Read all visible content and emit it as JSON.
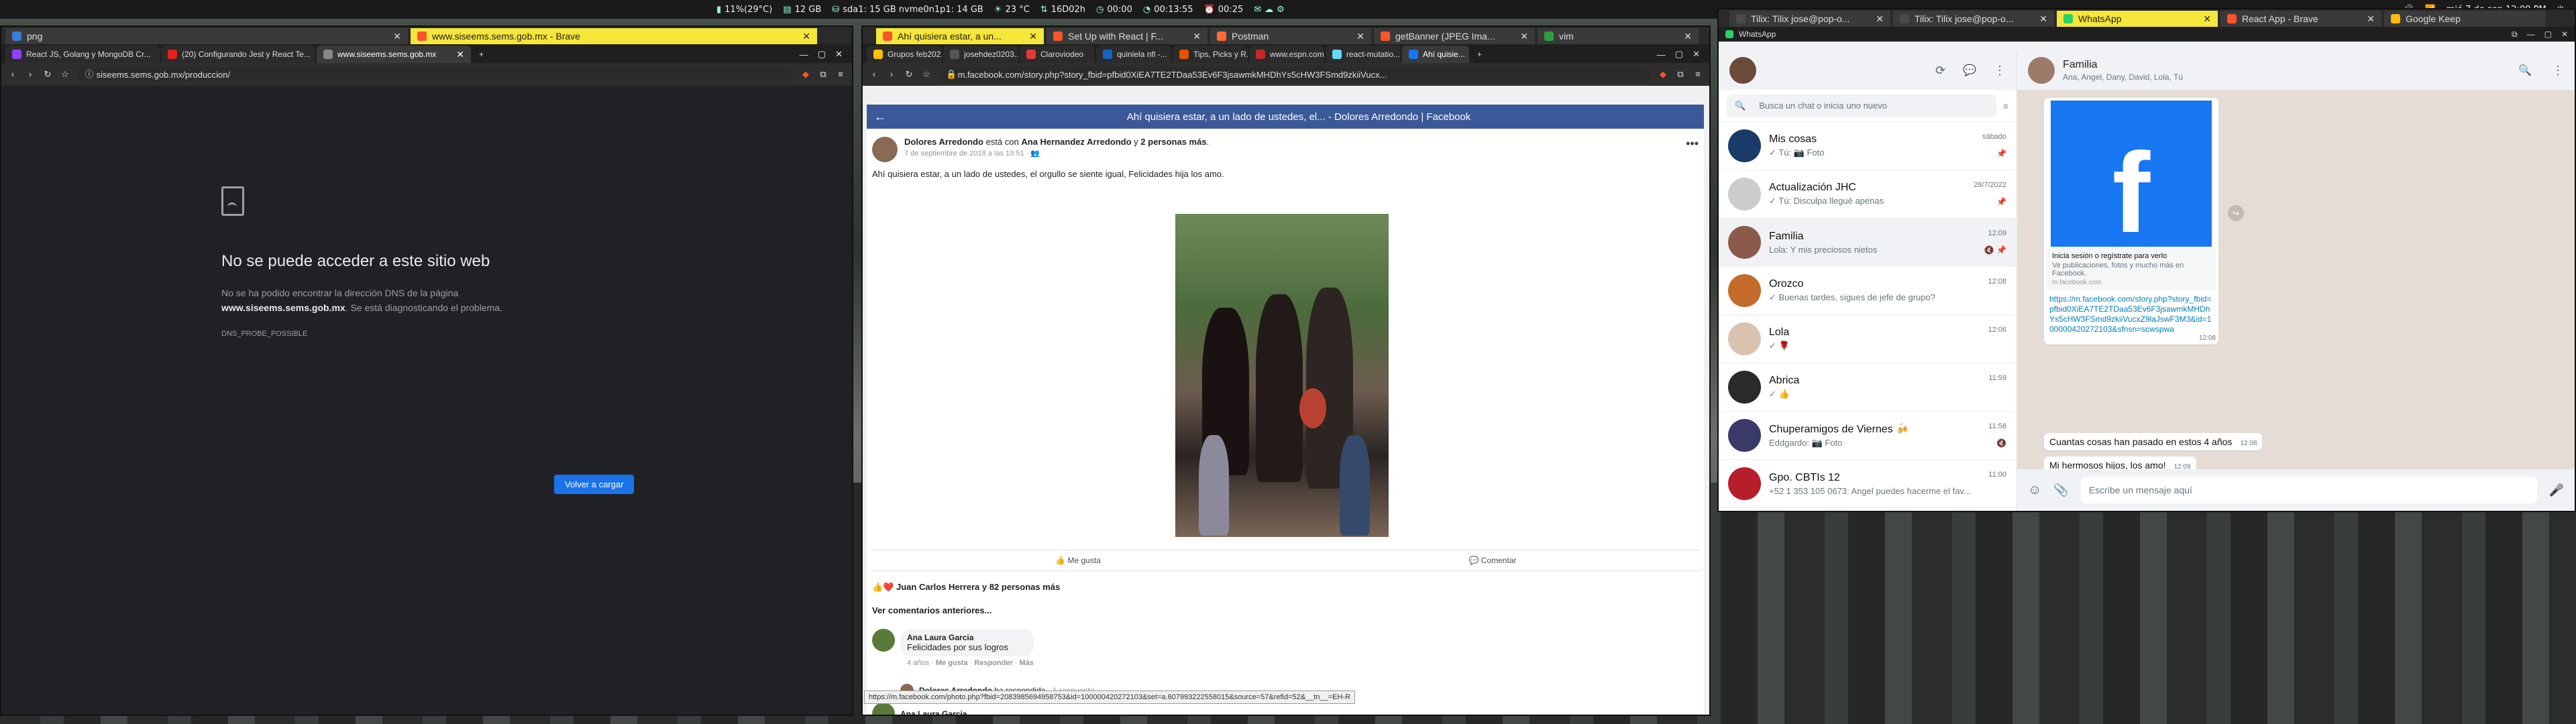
{
  "panel": {
    "weather_temp": "11%(29°C)",
    "memory": "12 GB",
    "disk": "sda1: 15 GB nvme0n1p1: 14 GB",
    "temp2": "23 °C",
    "net": "16D02h",
    "clock1": "00:00",
    "clock2": "00:13:55",
    "clock3": "00:25",
    "date": "mié 7 de sep 12:09 PM"
  },
  "win1": {
    "title_tab1": "png",
    "title_tab2": "www.siseems.sems.gob.mx - Brave",
    "tabs": [
      "React JS, Golang y MongoDB Cr...",
      "(20) Configurando Jest y React Te...",
      "www.siseems.sems.gob.mx"
    ],
    "url": "siseems.sems.gob.mx/produccion/",
    "error": {
      "heading": "No se puede acceder a este sitio web",
      "line1": "No se ha podido encontrar la dirección DNS de la página",
      "domain": "www.siseems.sems.gob.mx",
      "line2": ". Se está diagnosticando el problema.",
      "code": "DNS_PROBE_POSSIBLE",
      "reload": "Volver a cargar"
    }
  },
  "win2": {
    "title_tabs": [
      "Ahí quisiera estar, a un...",
      "Set Up with React | F...",
      "Postman",
      "getBanner (JPEG Ima...",
      "vim"
    ],
    "tabs": [
      "Grupos feb202...",
      "josehdez0203...",
      "Claroviodeo",
      "quiniela nfl -...",
      "Tips, Picks y R...",
      "www.espn.com...",
      "react-mutatio...",
      "Ahí quisie..."
    ],
    "url": "m.facebook.com/story.php?story_fbid=pfbid0XiEA7TE2TDaa53Ev6F3jsawmkMHDhYs5cHW3FSmd9zkiiVucx...",
    "fb_title": "Ahí quisiera estar, a un lado de ustedes, el... - Dolores Arredondo | Facebook",
    "post": {
      "author": "Dolores Arredondo",
      "with_text": " está con ",
      "with1": "Ana Hernandez Arredondo",
      "with_and": " y ",
      "with2": "2 personas más",
      "date": "7 de septiembre de 2018 a las 19:51 · ",
      "text": "Ahí quisiera estar, a un lado de ustedes, el orgullo se siente igual, Felicidades hija los amo.",
      "like": "Me gusta",
      "comment": "Comentar",
      "reactions": "Juan Carlos Herrera y 82 personas más",
      "more_comments": "Ver comentarios anteriores...",
      "c1_author": "Ana Laura Garcia",
      "c1_text": "Felicidades por sus logros",
      "c1_time": "4 años",
      "c1_like": "Me gusta",
      "c1_reply": "Responder",
      "c1_more": "Más",
      "reply_author": "Dolores Arredondo",
      "reply_text": " ha respondido",
      "reply_count": " · 1 respuesta",
      "c2_author": "Ana Laura Garcia"
    },
    "status_url": "https://m.facebook.com/photo.php?fbid=2083985694958753&id=100000420272103&set=a.607993222558015&source=57&refid=52&__tn__=EH-R"
  },
  "win3": {
    "title_tabs": [
      "Tilix: Tilix jose@pop-o...",
      "Tilix: Tilix jose@pop-o...",
      "WhatsApp",
      "React App - Brave",
      "Google Keep"
    ],
    "app_title": "WhatsApp",
    "search_placeholder": "Busca un chat o inicia uno nuevo",
    "chats": [
      {
        "name": "Mis cosas",
        "last": "✓ Tú: 📷 Foto",
        "time": "sábado",
        "pin": "📌"
      },
      {
        "name": "Actualización JHC",
        "last": "✓ Tú: Disculpa llegué apenas",
        "time": "28/7/2022",
        "pin": "📌"
      },
      {
        "name": "Familia",
        "last": "Lola: Y mis preciosos nietos",
        "time": "12:09",
        "pin": "🔇 📌"
      },
      {
        "name": "Orozco",
        "last": "✓ Buenas tardes, sigues de jefe de grupo?",
        "time": "12:08",
        "pin": ""
      },
      {
        "name": "Lola",
        "last": "✓ 🌹",
        "time": "12:06",
        "pin": ""
      },
      {
        "name": "Abrica",
        "last": "✓ 👍",
        "time": "11:59",
        "pin": ""
      },
      {
        "name": "Chuperamigos de Viernes 🍻",
        "last": "Eddgardo: 📷 Foto",
        "time": "11:58",
        "pin": "🔇"
      },
      {
        "name": "Gpo. CBTIs 12",
        "last": "+52 1 353 105 0673: Angel puedes hacerme el fav...",
        "time": "11:00",
        "pin": ""
      }
    ],
    "chat_name": "Familia",
    "chat_members": "Ana, Angel, Dany, David, Lola, Tú",
    "link_preview_title": "Inicia sesión o regístrate para verlo",
    "link_preview_desc": "Ve publicaciones, fotos y mucho más en Facebook.",
    "link_preview_domain": "m.facebook.com",
    "link_url": "https://m.facebook.com/story.php?story_fbid=pfbid0XiEA7TE2TDaa53Ev6F3jsawmkMHDhYs5cHW3FSmd9zkiiVucxZ9laJswF3M3&id=100000420272103&sfnsn=scwspwa",
    "link_time": "12:08",
    "messages": [
      {
        "text": "Cuantas cosas han pasado en estos 4 años",
        "time": "12:08"
      },
      {
        "text": "Mi hermosos hijos, los amo!",
        "time": "12:09"
      },
      {
        "text": "Y mis preciosos nietos",
        "time": "12:09"
      }
    ],
    "compose_placeholder": "Escribe un mensaje aquí"
  },
  "colors": {
    "fb_blue": "#3b5998",
    "wa_green": "#00a884",
    "brave_orange": "#fb542b"
  }
}
